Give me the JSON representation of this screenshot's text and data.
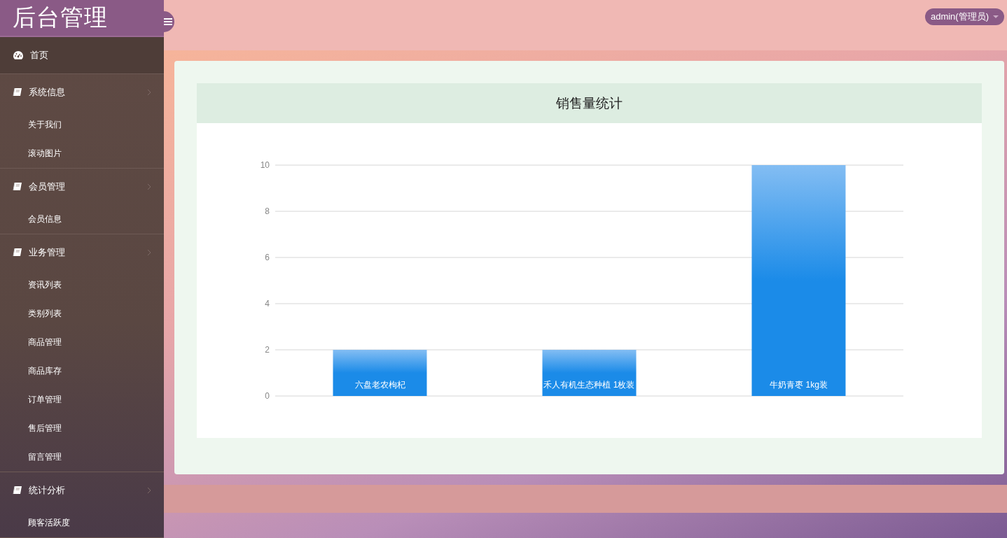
{
  "logo": {
    "title": "后台管理"
  },
  "header": {
    "user_menu": "admin(管理员)"
  },
  "sidebar": {
    "items": [
      {
        "label": "首页",
        "kind": "home",
        "selected": true
      },
      {
        "label": "系统信息",
        "kind": "group",
        "selected": false,
        "expanded": true,
        "children": [
          {
            "label": "关于我们",
            "selected": false
          },
          {
            "label": "滚动图片",
            "selected": false
          }
        ]
      },
      {
        "label": "会员管理",
        "kind": "group",
        "selected": false,
        "expanded": true,
        "children": [
          {
            "label": "会员信息",
            "selected": false
          }
        ]
      },
      {
        "label": "业务管理",
        "kind": "group",
        "selected": false,
        "expanded": true,
        "children": [
          {
            "label": "资讯列表",
            "selected": false
          },
          {
            "label": "类别列表",
            "selected": false
          },
          {
            "label": "商品管理",
            "selected": false
          },
          {
            "label": "商品库存",
            "selected": false
          },
          {
            "label": "订单管理",
            "selected": false
          },
          {
            "label": "售后管理",
            "selected": false
          },
          {
            "label": "留言管理",
            "selected": false
          }
        ]
      },
      {
        "label": "统计分析",
        "kind": "group",
        "selected": false,
        "expanded": true,
        "children": [
          {
            "label": "顾客活跃度",
            "selected": false
          }
        ]
      }
    ]
  },
  "panel": {
    "title": "销售量统计",
    "chart_data": {
      "type": "bar",
      "categories": [
        "六盘老农枸杞",
        "禾人有机生态种植 1枚装",
        "牛奶青枣 1kg装"
      ],
      "values": [
        2,
        2,
        10
      ],
      "ylim": [
        0,
        10
      ],
      "yticks": [
        0,
        2,
        4,
        6,
        8,
        10
      ],
      "grid": true
    }
  }
}
